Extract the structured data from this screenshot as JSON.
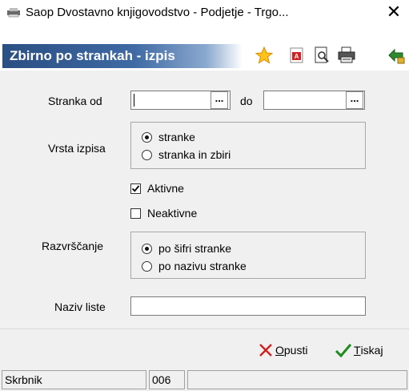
{
  "window": {
    "title": "Saop Dvostavno knjigovodstvo - Podjetje - Trgo...",
    "app_icon": "printer-app-icon",
    "close_icon": "close-icon"
  },
  "header": {
    "banner_title": "Zbirno po strankah - izpis",
    "toolbar_icons": [
      "star-icon",
      "pdf-export-icon",
      "print-preview-icon",
      "printer-icon",
      "run-icon"
    ]
  },
  "form": {
    "stranka_od_label": "Stranka od",
    "stranka_od_value": "",
    "do_label": "do",
    "do_value": "",
    "ellipsis_label": "...",
    "vrsta_izpisa_label": "Vrsta izpisa",
    "vrsta_izpisa_options": [
      "stranke",
      "stranka in zbiri"
    ],
    "vrsta_izpisa_selected": "stranke",
    "aktivne_label": "Aktivne",
    "aktivne_checked": true,
    "neaktivne_label": "Neaktivne",
    "neaktivne_checked": false,
    "razvrscanje_label": "Razvrščanje",
    "razvrscanje_options": [
      "po šifri stranke",
      "po nazivu stranke"
    ],
    "razvrscanje_selected": "po šifri stranke",
    "naziv_liste_label": "Naziv liste",
    "naziv_liste_value": ""
  },
  "footer": {
    "opusti_label": "Opusti",
    "opusti_underline": "O",
    "opusti_rest": "pusti",
    "tiskaj_label": "Tiskaj",
    "tiskaj_underline": "T",
    "tiskaj_rest": "iskaj"
  },
  "statusbar": {
    "user": "Skrbnik",
    "code": "006",
    "extra": ""
  },
  "colors": {
    "banner_dark": "#2a4f83",
    "banner_light": "#8ba9cf",
    "cancel_red": "#d21f1f",
    "ok_green": "#1f8a1f"
  }
}
